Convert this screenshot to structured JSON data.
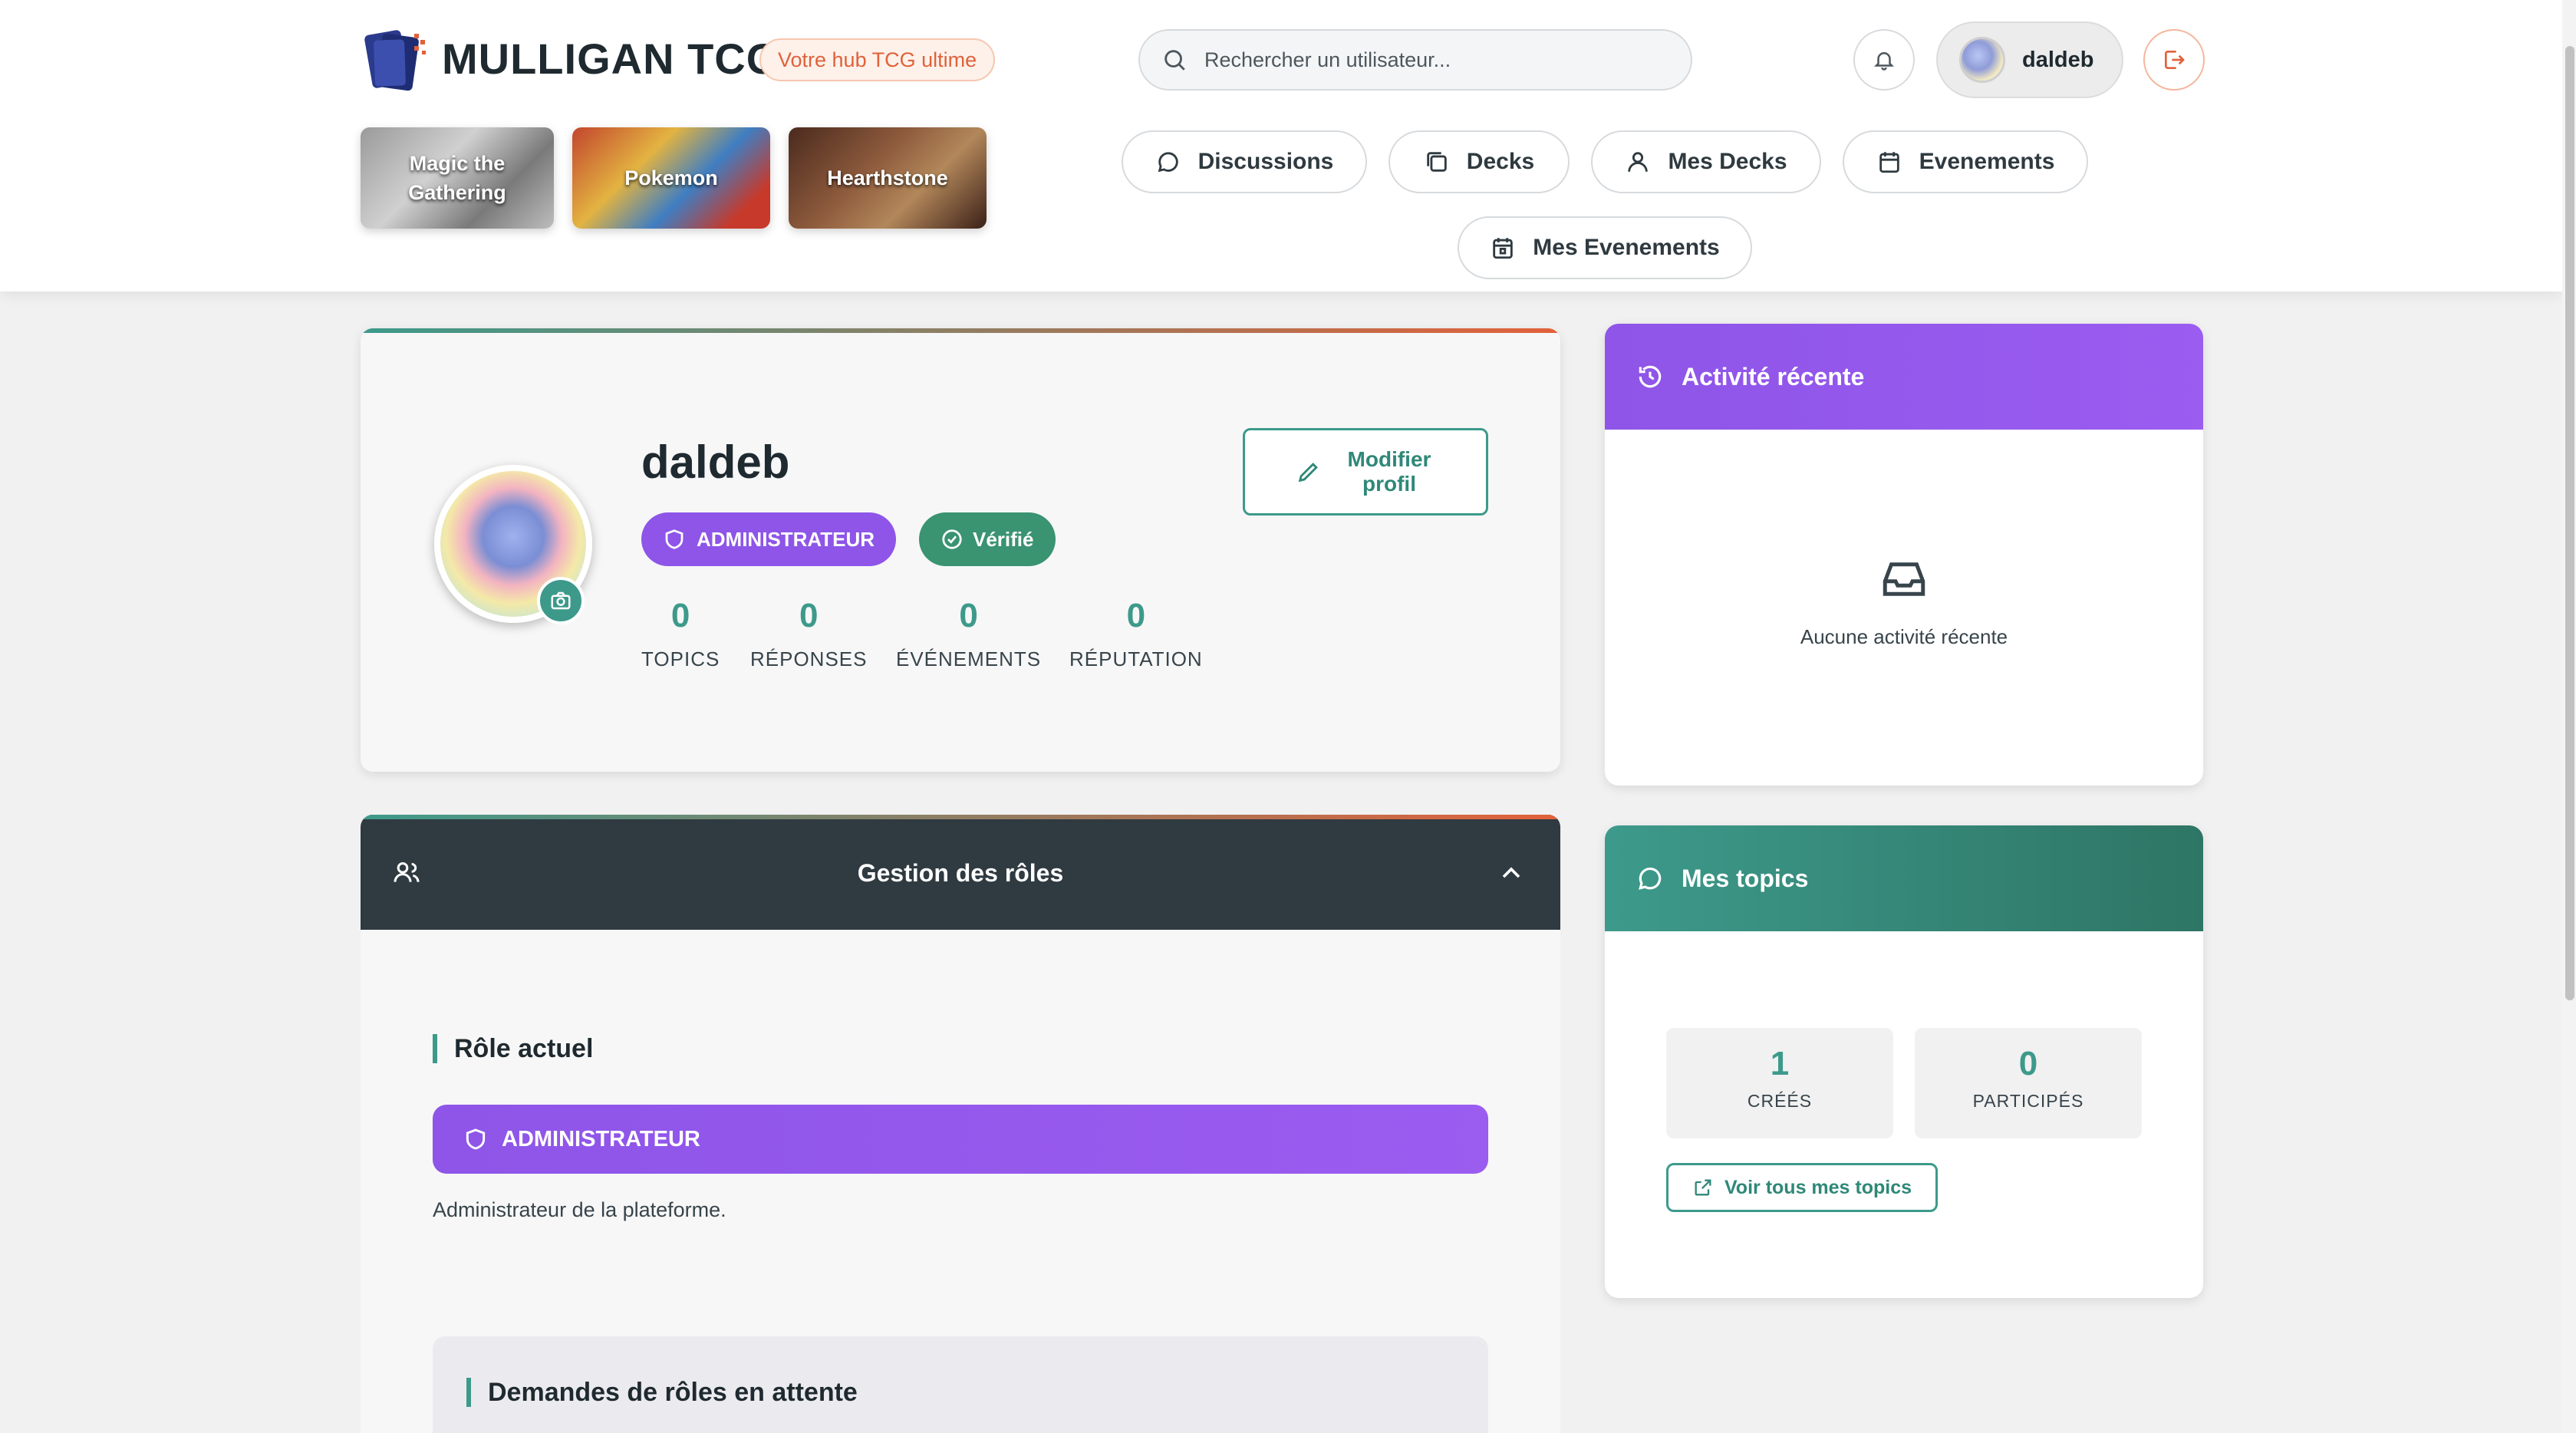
{
  "header": {
    "brand": "MULLIGAN TCG",
    "tagline": "Votre hub TCG ultime",
    "search_placeholder": "Rechercher un utilisateur...",
    "user": "daldeb"
  },
  "games": [
    {
      "label": "Magic the Gathering"
    },
    {
      "label": "Pokemon"
    },
    {
      "label": "Hearthstone"
    }
  ],
  "nav": {
    "discussions": "Discussions",
    "decks": "Decks",
    "my_decks": "Mes Decks",
    "events": "Evenements",
    "my_events": "Mes Evenements"
  },
  "profile": {
    "username": "daldeb",
    "role_badge": "ADMINISTRATEUR",
    "verified_badge": "Vérifié",
    "edit_label": "Modifier profil",
    "stats": [
      {
        "value": "0",
        "label": "TOPICS"
      },
      {
        "value": "0",
        "label": "RÉPONSES"
      },
      {
        "value": "0",
        "label": "ÉVÉNEMENTS"
      },
      {
        "value": "0",
        "label": "RÉPUTATION"
      }
    ]
  },
  "roles": {
    "title": "Gestion des rôles",
    "current_title": "Rôle actuel",
    "current_role": "ADMINISTRATEUR",
    "current_desc": "Administrateur de la plateforme.",
    "pending_title": "Demandes de rôles en attente"
  },
  "activity": {
    "title": "Activité récente",
    "empty": "Aucune activité récente"
  },
  "topics": {
    "title": "Mes topics",
    "created_value": "1",
    "created_label": "CRÉÉS",
    "participated_value": "0",
    "participated_label": "PARTICIPÉS",
    "link": "Voir tous mes topics"
  },
  "colors": {
    "accent_teal": "#3d9a8b",
    "accent_orange": "#e2613a",
    "admin_purple": "#8e55e8",
    "verified_green": "#3a9371",
    "dark_header": "#2f3a41"
  }
}
